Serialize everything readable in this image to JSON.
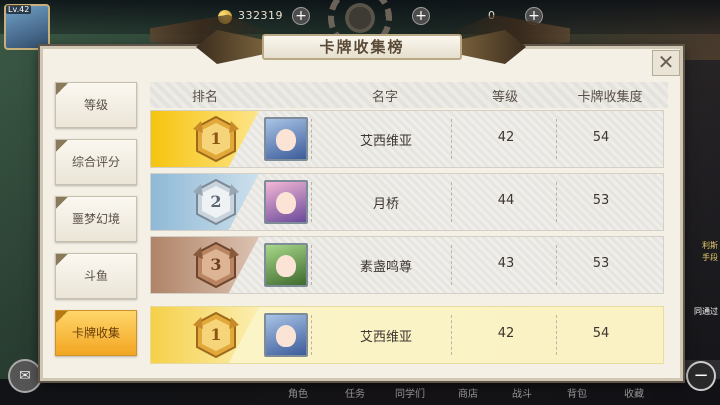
{
  "hud": {
    "level": "Lv.42",
    "gold": "332319",
    "stat_2": "0",
    "stat_3": "0",
    "right_labels": [
      "利斯",
      "手段",
      "同通过"
    ],
    "bottom_items": [
      "角色",
      "任务",
      "同学们",
      "商店",
      "战斗",
      "背包",
      "收藏"
    ],
    "chat_icon": "chat-bubble-icon",
    "minus_label": "−"
  },
  "dialog": {
    "title": "卡牌收集榜",
    "close_label": "✕"
  },
  "tabs": [
    {
      "label": "等级",
      "active": false
    },
    {
      "label": "综合评分",
      "active": false
    },
    {
      "label": "噩梦幻境",
      "active": false
    },
    {
      "label": "斗鱼",
      "active": false
    },
    {
      "label": "卡牌收集",
      "active": true
    }
  ],
  "table": {
    "headers": [
      "排名",
      "名字",
      "等级",
      "卡牌收集度"
    ],
    "rows": [
      {
        "rank": "1",
        "name": "艾西维亚",
        "level": "42",
        "collection": "54",
        "medal": "gold",
        "avatar": "blue-hair-maid-avatar"
      },
      {
        "rank": "2",
        "name": "月桥",
        "level": "44",
        "collection": "53",
        "medal": "silver",
        "avatar": "pink-hair-girl-avatar"
      },
      {
        "rank": "3",
        "name": "素盏鸣尊",
        "level": "43",
        "collection": "53",
        "medal": "bronze",
        "avatar": "green-hair-girl-avatar"
      }
    ],
    "self_row": {
      "rank": "1",
      "name": "艾西维亚",
      "level": "42",
      "collection": "54",
      "medal": "gold",
      "avatar": "blue-hair-maid-avatar"
    }
  },
  "colors": {
    "gold": "#f3c21f",
    "silver": "#9cc3dd",
    "bronze": "#b88a6c",
    "active_tab": "#f2a623",
    "self_row": "#faf2c4"
  }
}
